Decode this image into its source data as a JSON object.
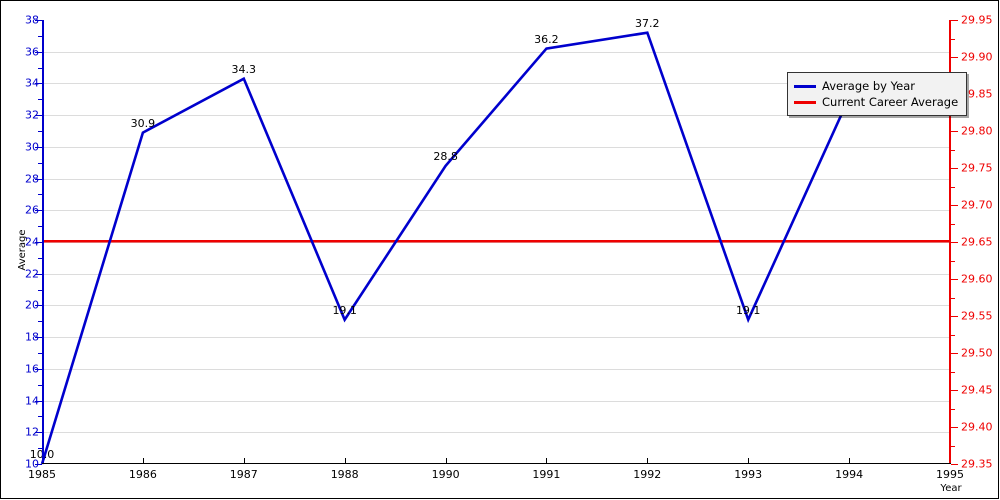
{
  "chart_data": {
    "type": "line",
    "title": "",
    "xlabel": "Year",
    "ylabel": "Average",
    "grid": true,
    "legend_position": "top-right",
    "categories": [
      "1985",
      "1986",
      "1987",
      "1988",
      "1990",
      "1991",
      "1992",
      "1993",
      "1994",
      "1995"
    ],
    "x_tick_labels": [
      "1985",
      "1986",
      "1987",
      "1988",
      "1990",
      "1991",
      "1992",
      "1993",
      "1994",
      "1995"
    ],
    "ylim": [
      10,
      38
    ],
    "y_tick_labels": [
      "10",
      "12",
      "14",
      "16",
      "18",
      "20",
      "22",
      "24",
      "26",
      "28",
      "30",
      "32",
      "34",
      "36",
      "38"
    ],
    "y_tick_values": [
      10,
      12,
      14,
      16,
      18,
      20,
      22,
      24,
      26,
      28,
      30,
      32,
      34,
      36,
      38
    ],
    "y2lim": [
      29.35,
      29.95
    ],
    "y2_tick_labels": [
      "29.35",
      "29.40",
      "29.45",
      "29.50",
      "29.55",
      "29.60",
      "29.65",
      "29.70",
      "29.75",
      "29.80",
      "29.85",
      "29.90",
      "29.95"
    ],
    "y2_tick_values": [
      29.35,
      29.4,
      29.45,
      29.5,
      29.55,
      29.6,
      29.65,
      29.7,
      29.75,
      29.8,
      29.85,
      29.9,
      29.95
    ],
    "series": [
      {
        "name": "Average by Year",
        "color": "#0000cd",
        "type": "line",
        "x": [
          "1985",
          "1986",
          "1987",
          "1988",
          "1990",
          "1991",
          "1992",
          "1993",
          "1994"
        ],
        "values": [
          10.0,
          30.9,
          34.3,
          19.1,
          28.8,
          36.2,
          37.2,
          19.1,
          33.1
        ],
        "point_labels": [
          "10.0",
          "30.9",
          "34.3",
          "19.1",
          "28.8",
          "36.2",
          "37.2",
          "19.1",
          "33.1"
        ]
      },
      {
        "name": "Current Career Average",
        "color": "#ee0000",
        "type": "hline",
        "value": 24.05,
        "value_right_axis": 29.65
      }
    ],
    "legend": [
      {
        "label": "Average by Year",
        "color": "#0000cd"
      },
      {
        "label": "Current Career Average",
        "color": "#ee0000"
      }
    ]
  },
  "colors": {
    "series_primary": "#0000cd",
    "series_secondary": "#ee0000",
    "grid": "#dcdcdc",
    "background": "#ffffff",
    "text": "#000000"
  }
}
